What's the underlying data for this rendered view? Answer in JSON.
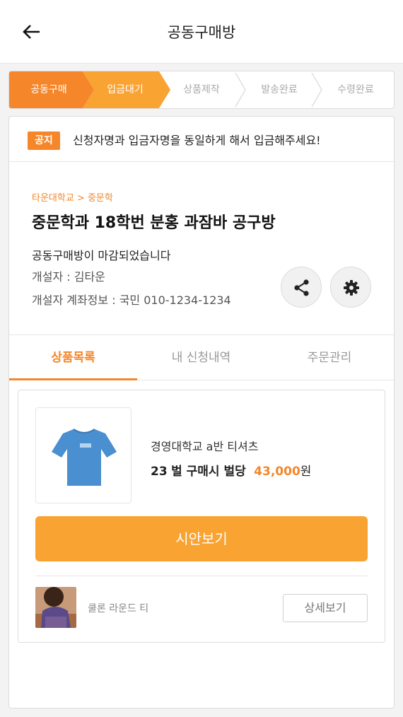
{
  "header": {
    "title": "공동구매방",
    "back_icon": "arrow-left-icon"
  },
  "steps": [
    {
      "label": "공동구매",
      "state": "active",
      "color": "#f5862a"
    },
    {
      "label": "입금대기",
      "state": "active",
      "color": "#f9a333"
    },
    {
      "label": "상품제작",
      "state": "inactive"
    },
    {
      "label": "발송완료",
      "state": "inactive"
    },
    {
      "label": "수령완료",
      "state": "inactive"
    }
  ],
  "notice": {
    "badge": "공지",
    "text": "신청자명과 입금자명을 동일하게 해서 입금해주세요!"
  },
  "room": {
    "breadcrumb": "타운대학교 > 중문학",
    "title": "중문학과 18학번 분홍 과잠바 공구방",
    "status": "공동구매방이 마감되었습니다",
    "creator": "개설자 : 김타운",
    "account": "개설자 계좌정보 : 국민 010-1234-1234",
    "share_icon": "share-icon",
    "settings_icon": "gear-icon"
  },
  "tabs": [
    {
      "label": "상품목록",
      "active": true
    },
    {
      "label": "내 신청내역",
      "active": false
    },
    {
      "label": "주문관리",
      "active": false
    }
  ],
  "product": {
    "name": "경영대학교 a반 티셔츠",
    "qty": "23",
    "per_text": "벌 구매시 벌당",
    "price": "43,000",
    "currency": "원",
    "preview_label": "시안보기",
    "thumb_icon": "tshirt-icon",
    "sub_name": "쿨론 라운드 티",
    "detail_label": "상세보기"
  },
  "colors": {
    "accent": "#f5862a",
    "accent_light": "#f9a333",
    "tshirt": "#4a8fd0"
  }
}
